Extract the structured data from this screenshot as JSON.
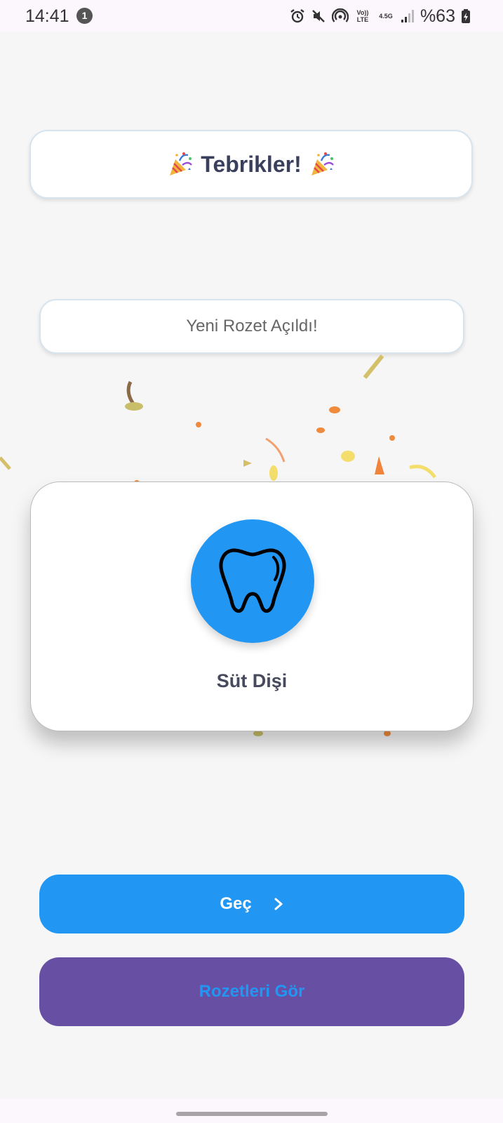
{
  "status_bar": {
    "time": "14:41",
    "notification_count": "1",
    "network_volte": "Vo)) LTE",
    "network_type": "4.5G",
    "battery": "%63"
  },
  "header": {
    "title": "Tebrikler!",
    "title_icon": "party-popper-icon"
  },
  "subtitle": "Yeni Rozet Açıldı!",
  "badge": {
    "name": "Süt Dişi",
    "icon": "tooth-icon",
    "color": "#2196f3"
  },
  "buttons": {
    "next_label": "Geç",
    "next_icon": "chevron-right-icon",
    "next_color": "#2196f3",
    "badges_label": "Rozetleri Gör",
    "badges_color": "#6750a4"
  }
}
